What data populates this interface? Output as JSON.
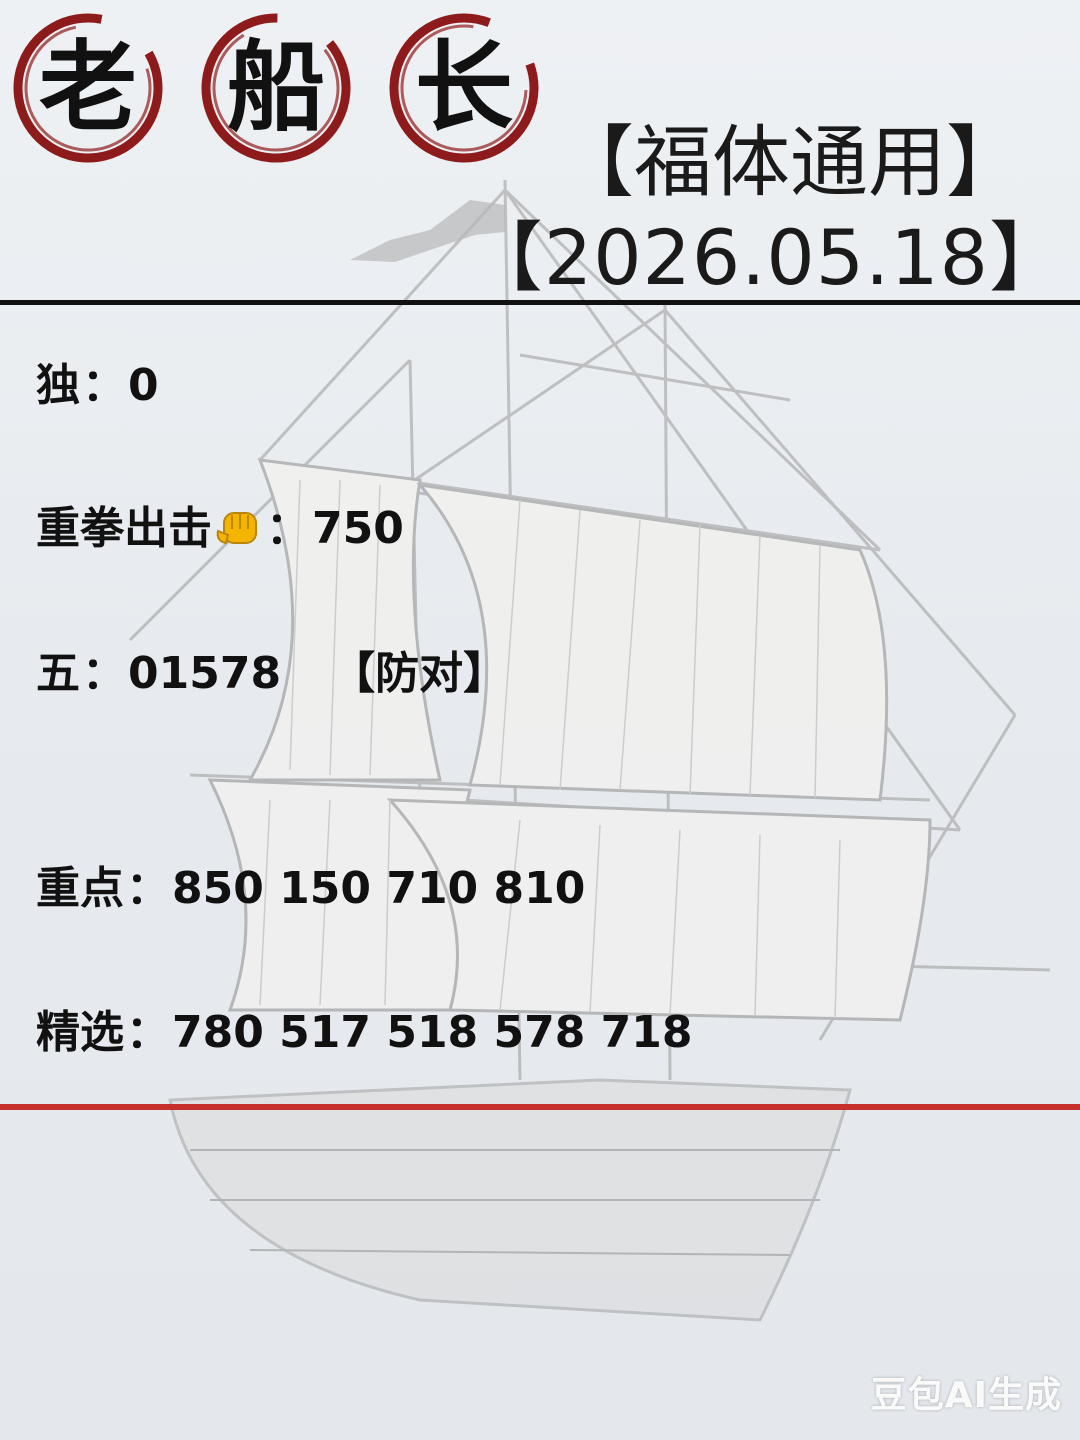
{
  "logo": {
    "chars": [
      "老",
      "船",
      "长"
    ],
    "ring_color": "#8e1b1b"
  },
  "header": {
    "line1": "【福体通用】",
    "line2": "【2026.05.18】"
  },
  "rows": {
    "du": {
      "label": "独",
      "value": "0"
    },
    "zhongquan": {
      "label": "重拳出击",
      "icon": "fist-emoji",
      "value": "750"
    },
    "wu": {
      "label": "五",
      "value": "01578",
      "note": "【防对】"
    },
    "zhongdian": {
      "label": "重点",
      "value": "850 150 710 810"
    },
    "jingxuan": {
      "label": "精选",
      "value": "780 517 518 578 718"
    }
  },
  "separator": "：",
  "watermark": "豆包AI生成",
  "colors": {
    "top_rule": "#111111",
    "bottom_rule": "#c6302c",
    "background": "#e9edf1"
  }
}
